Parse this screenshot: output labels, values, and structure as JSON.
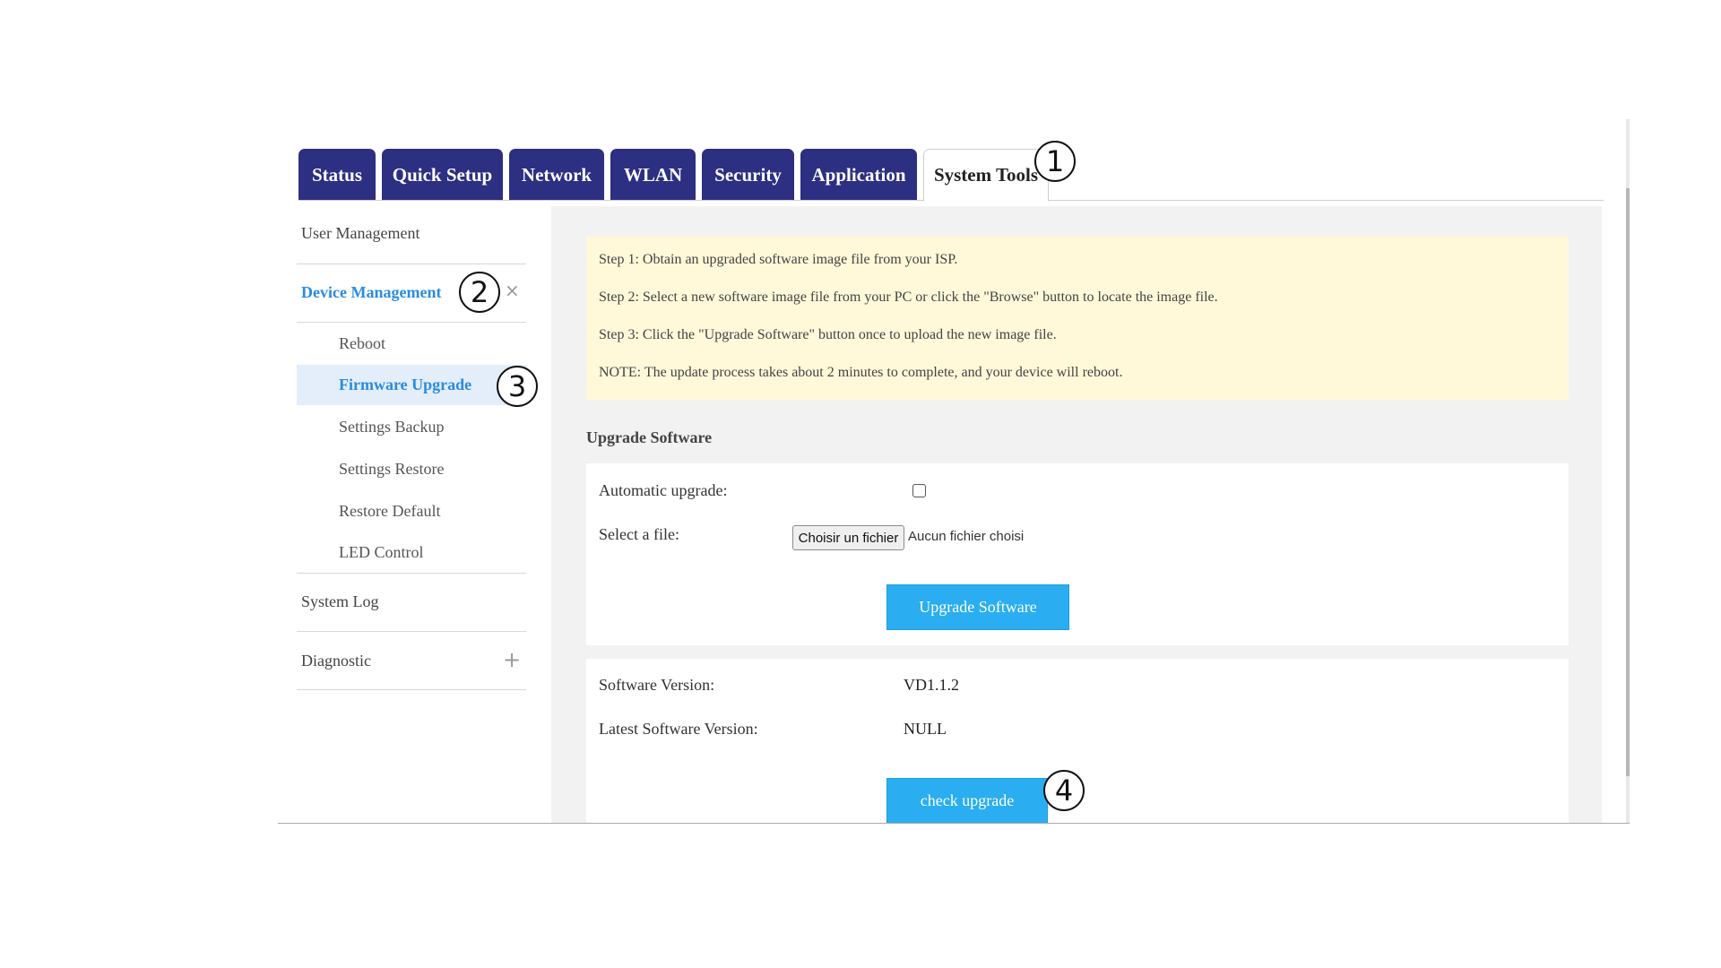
{
  "tabs": [
    {
      "label": "Status"
    },
    {
      "label": "Quick Setup"
    },
    {
      "label": "Network"
    },
    {
      "label": "WLAN"
    },
    {
      "label": "Security"
    },
    {
      "label": "Application"
    },
    {
      "label": "System Tools",
      "active": true
    }
  ],
  "callouts": [
    "1",
    "2",
    "3",
    "4"
  ],
  "sidebar": {
    "user_management": "User Management",
    "device_management": "Device Management",
    "sub_items": [
      "Reboot",
      "Firmware Upgrade",
      "Settings Backup",
      "Settings Restore",
      "Restore Default",
      "LED Control"
    ],
    "active_sub": "Firmware Upgrade",
    "system_log": "System Log",
    "diagnostic": "Diagnostic",
    "close_icon": "×",
    "expand_icon": "+"
  },
  "notice": {
    "step1": "Step 1: Obtain an upgraded software image file from your ISP.",
    "step2": "Step 2: Select a new software image file from your PC or click the \"Browse\" button to locate the image file.",
    "step3": "Step 3: Click the \"Upgrade Software\" button once to upload the new image file.",
    "note": "NOTE: The update process takes about 2 minutes to complete, and your device will reboot."
  },
  "upgrade": {
    "title": "Upgrade Software",
    "auto_label": "Automatic upgrade:",
    "auto_checked": false,
    "file_label": "Select a file:",
    "file_button": "Choisir un fichier",
    "file_status": "Aucun fichier choisi",
    "upgrade_button": "Upgrade Software"
  },
  "version": {
    "software_label": "Software Version:",
    "software_value": "VD1.1.2",
    "latest_label": "Latest Software Version:",
    "latest_value": "NULL",
    "check_button": "check upgrade"
  },
  "colors": {
    "tab_bg": "#2d2f82",
    "accent_blue": "#2aaef1",
    "active_link": "#2a8be0",
    "notice_bg": "#fff8d9"
  }
}
